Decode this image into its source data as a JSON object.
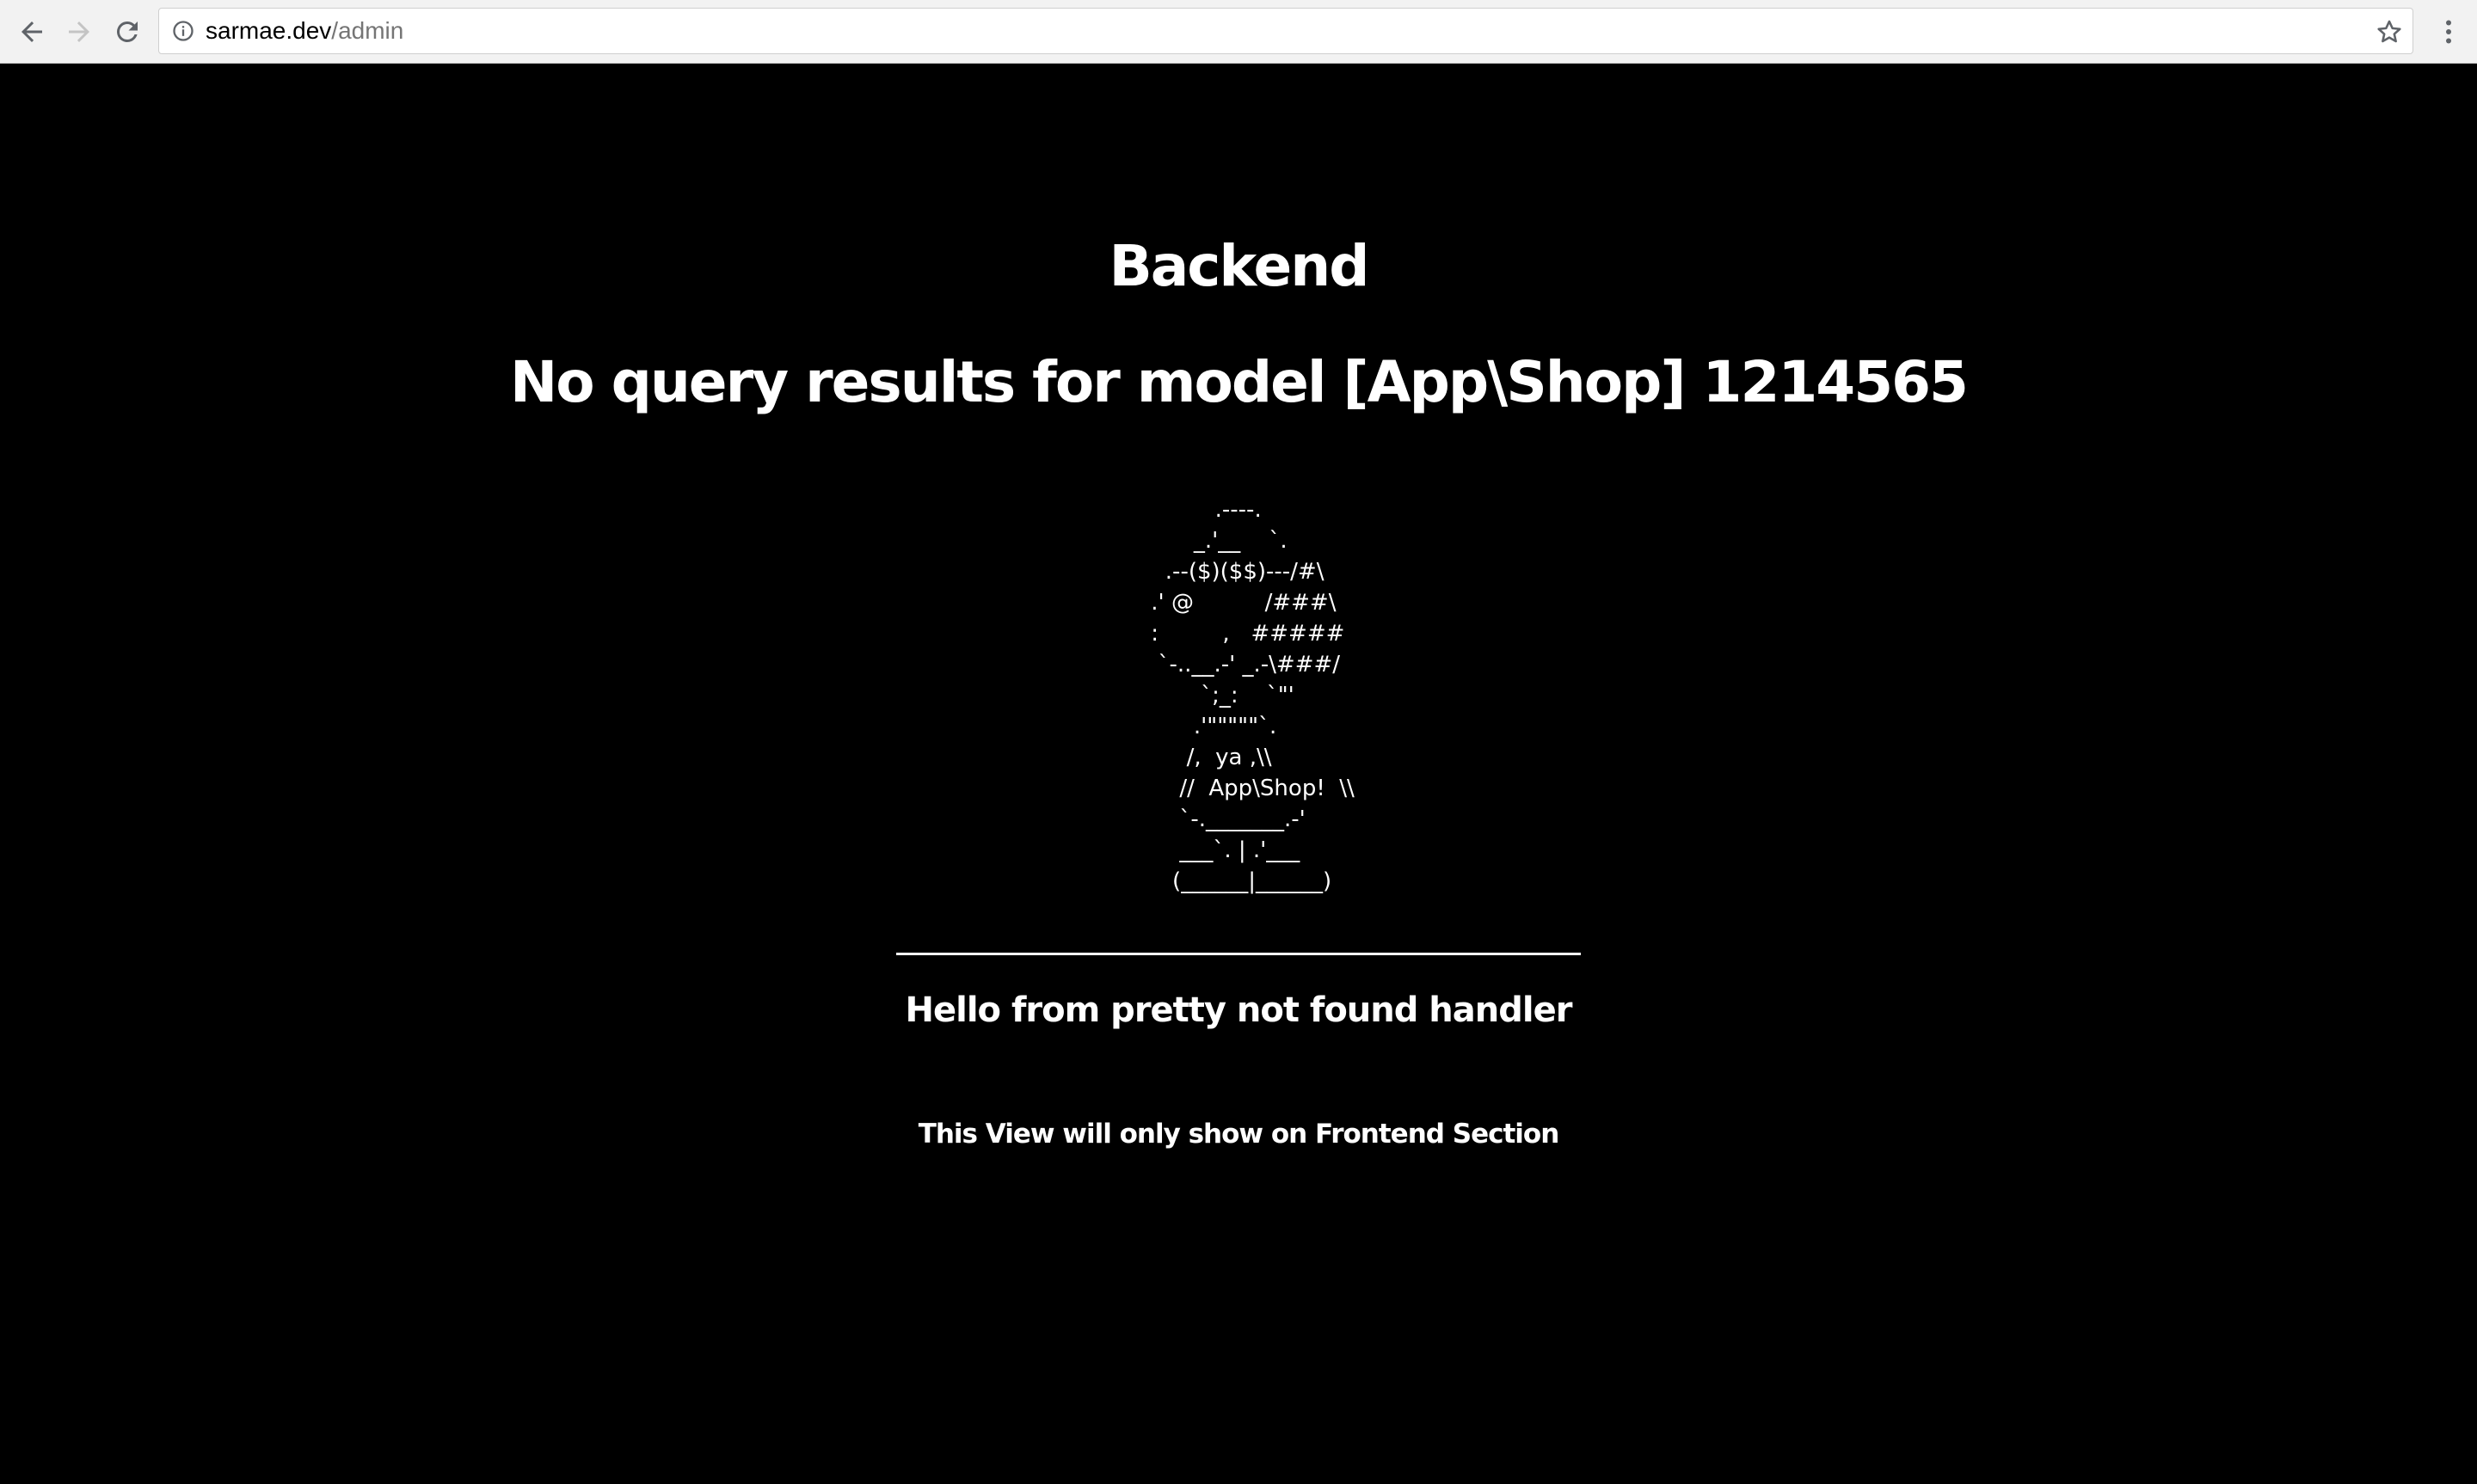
{
  "browser": {
    "url_host": "sarmae.dev",
    "url_path": "/admin",
    "icons": {
      "back": "arrow-left-icon",
      "forward": "arrow-right-icon",
      "reload": "reload-icon",
      "site_info": "info-circle-icon",
      "bookmark": "star-icon",
      "menu": "vertical-dots-icon"
    }
  },
  "page": {
    "section_title": "Backend",
    "error_message": "No query results for model [App\\Shop] 1214565",
    "ascii_art": "          .----.\n       _.'__    `.\n   .--($)($$)---/#\\\n .' @          /###\\\n :         ,   #####\n  `-..__.-' _.-\\###/\n        `;_:    `\"'\n       .'\"\"\"\"\"`.\n      /,  ya ,\\\\\n     //  App\\Shop!  \\\\\n     `-._______.-'\n     ___`. | .'___\n    (______|______)",
    "handler_message": "Hello from pretty not found handler",
    "frontend_note": "This View will only show on Frontend Section"
  },
  "colors": {
    "page_background": "#000000",
    "text": "#ffffff",
    "toolbar_background": "#f2f2f2",
    "url_path": "#757575"
  }
}
